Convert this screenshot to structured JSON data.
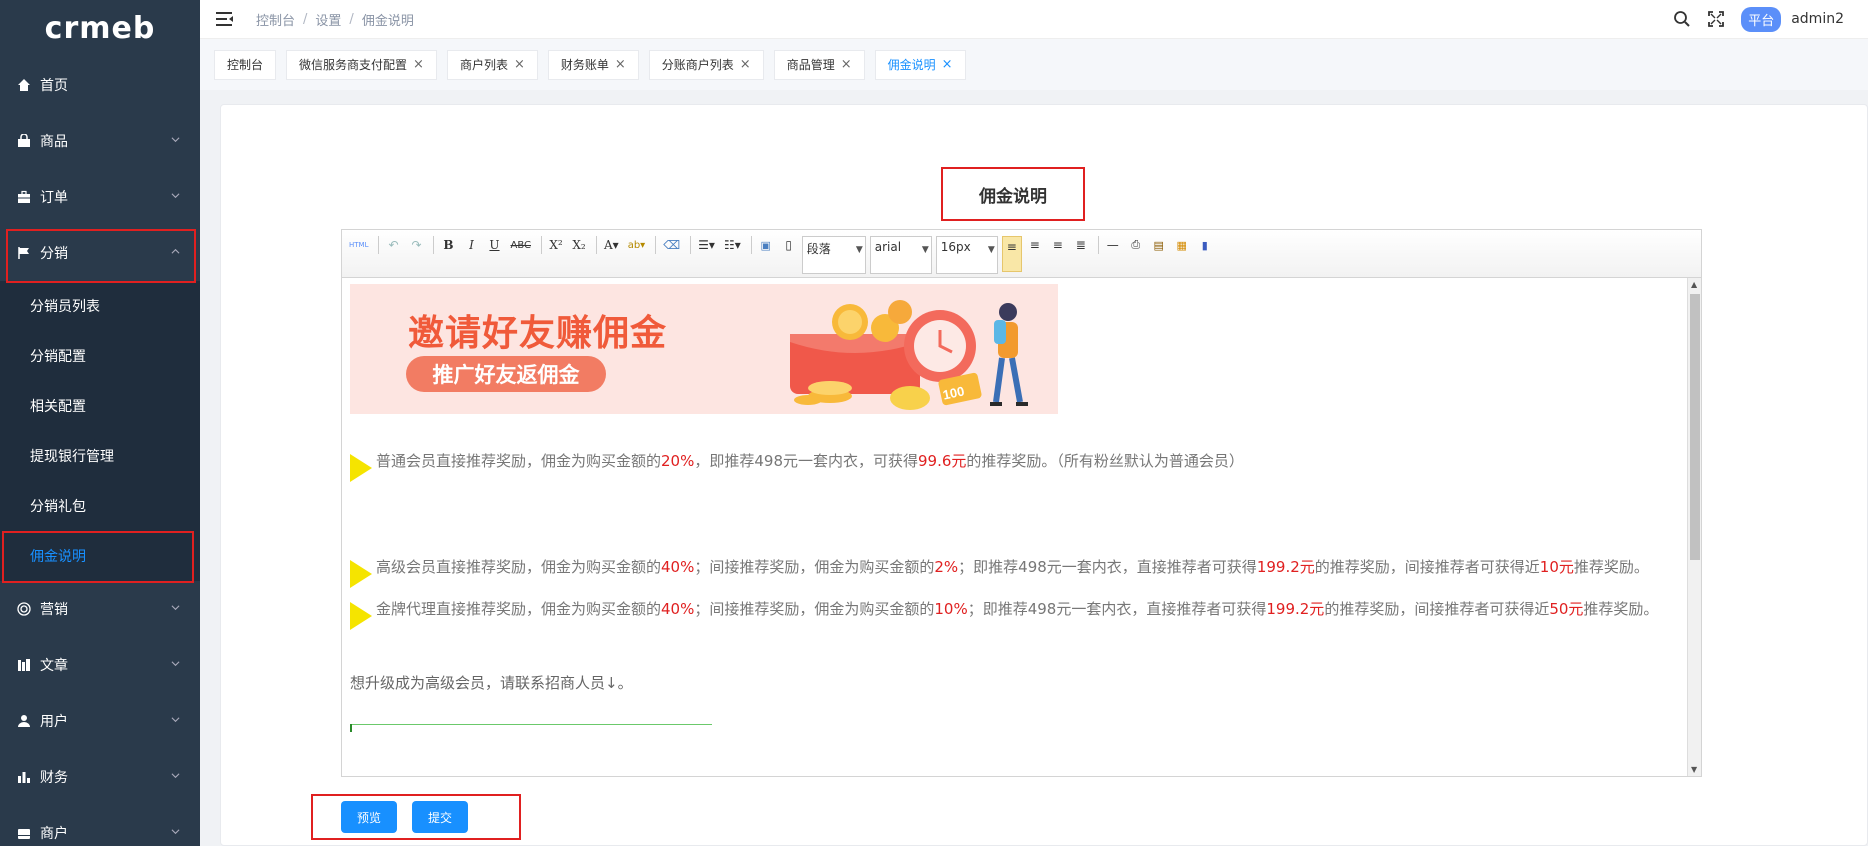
{
  "app": {
    "logo": "crmeb"
  },
  "sidebar": {
    "items": [
      {
        "label": "首页",
        "icon": "home-icon"
      },
      {
        "label": "商品",
        "icon": "bag-icon"
      },
      {
        "label": "订单",
        "icon": "briefcase-icon"
      },
      {
        "label": "分销",
        "icon": "flag-icon"
      },
      {
        "label": "营销",
        "icon": "target-icon"
      },
      {
        "label": "文章",
        "icon": "article-icon"
      },
      {
        "label": "用户",
        "icon": "user-icon"
      },
      {
        "label": "财务",
        "icon": "bar-chart-icon"
      },
      {
        "label": "商户",
        "icon": "store-icon"
      }
    ],
    "sub_items": [
      "分销员列表",
      "分销配置",
      "相关配置",
      "提现银行管理",
      "分销礼包",
      "佣金说明"
    ]
  },
  "header": {
    "breadcrumb": [
      "控制台",
      "设置",
      "佣金说明"
    ],
    "badge": "平台",
    "user": "admin2"
  },
  "tags": [
    {
      "label": "控制台",
      "closable": false
    },
    {
      "label": "微信服务商支付配置",
      "closable": true
    },
    {
      "label": "商户列表",
      "closable": true
    },
    {
      "label": "财务账单",
      "closable": true
    },
    {
      "label": "分账商户列表",
      "closable": true
    },
    {
      "label": "商品管理",
      "closable": true
    },
    {
      "label": "佣金说明",
      "closable": true
    }
  ],
  "main": {
    "title": "佣金说明",
    "toolbar": {
      "paragraph": "段落",
      "font": "arial",
      "size": "16px"
    },
    "banner": {
      "title": "邀请好友赚佣金",
      "pill": "推广好友返佣金",
      "badge": "100"
    },
    "p1": {
      "a": "普通会员直接推荐奖励，佣金为购买金额的",
      "b": "20%",
      "c": "，即推荐498元一套内衣，可获得",
      "d": "99.6元",
      "e": "的推荐奖励。（所有粉丝默认为普通会员）"
    },
    "p2": {
      "a": "高级会员直接推荐奖励，佣金为购买金额的",
      "b": "40%",
      "c": "；间接推荐奖励，佣金为购买金额的",
      "d": "2%",
      "e": "；即推荐498元一套内衣，直接推荐者可获得",
      "f": "199.2元",
      "g": "的推荐奖励，间接推荐者可获得近",
      "h": "10元",
      "i": "推荐奖励。"
    },
    "p3": {
      "a": "金牌代理直接推荐奖励，佣金为购买金额的",
      "b": "40%",
      "c": "；间接推荐奖励，佣金为购买金额的",
      "d": "10%",
      "e": "；即推荐498元一套内衣，直接推荐者可获得",
      "f": "199.2元",
      "g": "的推荐奖励，间接推荐者可获得近",
      "h": "50元",
      "i": "推荐奖励。"
    },
    "p4": "想升级成为高级会员，请联系招商人员↓。",
    "preview_label": "预览",
    "submit_label": "提交"
  },
  "colors": {
    "sidebar": "#2a3a4b",
    "accent": "#1890ff",
    "highlight_box": "#e02020"
  }
}
